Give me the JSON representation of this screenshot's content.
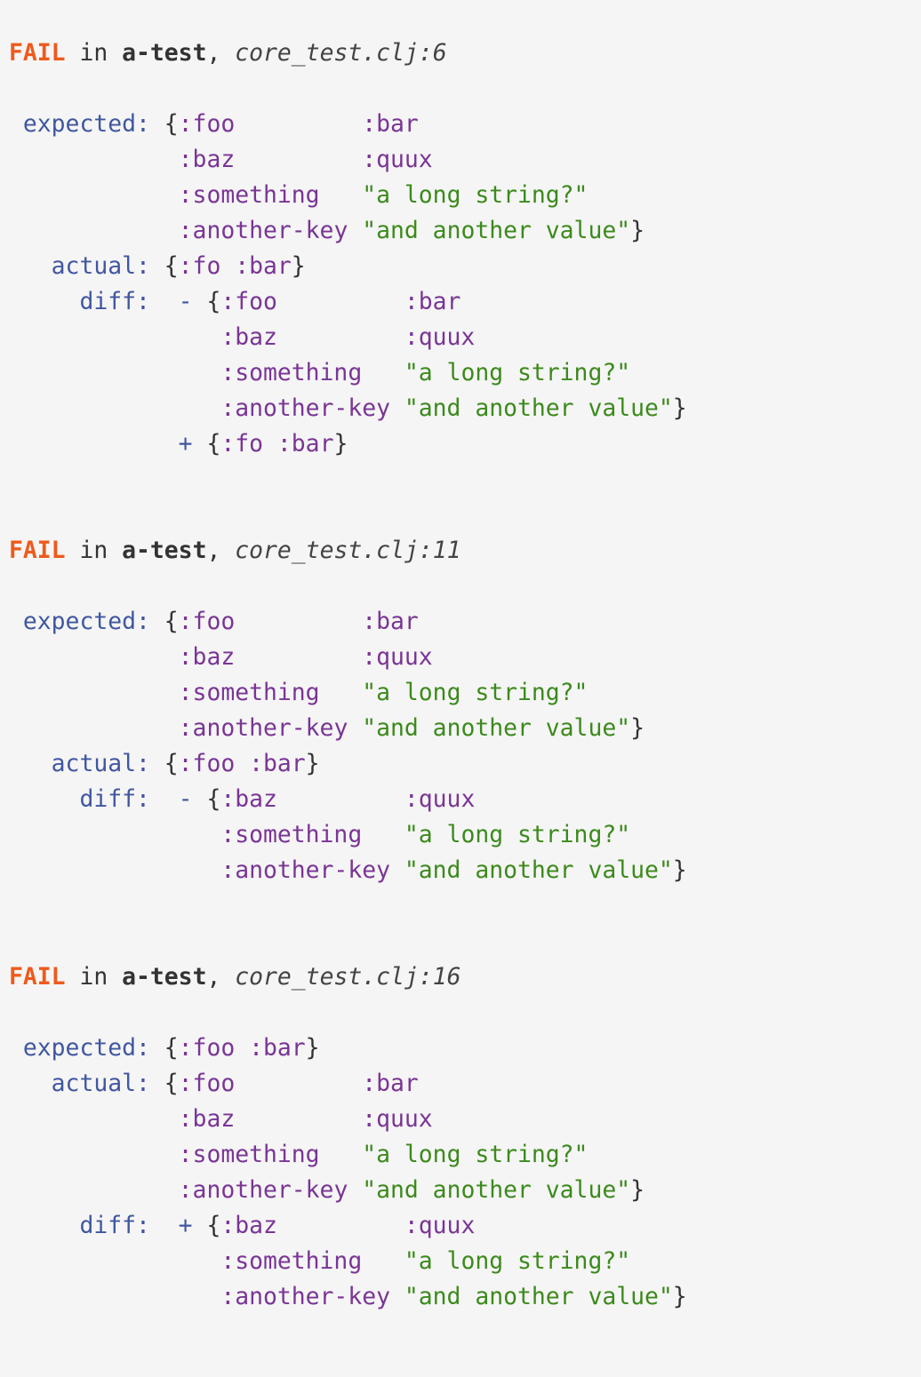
{
  "colors": {
    "background": "#f5f5f5",
    "fail": "#ee5a1c",
    "label": "#4057a0",
    "keyword": "#7a3595",
    "string": "#3c8a1c",
    "text": "#333333"
  },
  "failures": [
    {
      "header": {
        "fail": "FAIL",
        "in": " in ",
        "test": "a-test",
        "comma": ", ",
        "location": "core_test.clj:6"
      },
      "lines": [
        [
          [
            "label",
            " expected: "
          ],
          [
            "punct",
            "{"
          ],
          [
            "key",
            ":foo         :bar"
          ]
        ],
        [
          [
            "ws",
            "            "
          ],
          [
            "key",
            ":baz         :quux"
          ]
        ],
        [
          [
            "ws",
            "            "
          ],
          [
            "key",
            ":something   "
          ],
          [
            "str",
            "\"a long string?\""
          ]
        ],
        [
          [
            "ws",
            "            "
          ],
          [
            "key",
            ":another-key "
          ],
          [
            "str",
            "\"and another value\""
          ],
          [
            "punct",
            "}"
          ]
        ],
        [
          [
            "label",
            "   actual: "
          ],
          [
            "punct",
            "{"
          ],
          [
            "key",
            ":fo :bar"
          ],
          [
            "punct",
            "}"
          ]
        ],
        [
          [
            "label",
            "     diff: "
          ],
          [
            "op",
            " - "
          ],
          [
            "punct",
            "{"
          ],
          [
            "key",
            ":foo         :bar"
          ]
        ],
        [
          [
            "ws",
            "               "
          ],
          [
            "key",
            ":baz         :quux"
          ]
        ],
        [
          [
            "ws",
            "               "
          ],
          [
            "key",
            ":something   "
          ],
          [
            "str",
            "\"a long string?\""
          ]
        ],
        [
          [
            "ws",
            "               "
          ],
          [
            "key",
            ":another-key "
          ],
          [
            "str",
            "\"and another value\""
          ],
          [
            "punct",
            "}"
          ]
        ],
        [
          [
            "ws",
            "           "
          ],
          [
            "op",
            " + "
          ],
          [
            "punct",
            "{"
          ],
          [
            "key",
            ":fo :bar"
          ],
          [
            "punct",
            "}"
          ]
        ]
      ]
    },
    {
      "header": {
        "fail": "FAIL",
        "in": " in ",
        "test": "a-test",
        "comma": ", ",
        "location": "core_test.clj:11"
      },
      "lines": [
        [
          [
            "label",
            " expected: "
          ],
          [
            "punct",
            "{"
          ],
          [
            "key",
            ":foo         :bar"
          ]
        ],
        [
          [
            "ws",
            "            "
          ],
          [
            "key",
            ":baz         :quux"
          ]
        ],
        [
          [
            "ws",
            "            "
          ],
          [
            "key",
            ":something   "
          ],
          [
            "str",
            "\"a long string?\""
          ]
        ],
        [
          [
            "ws",
            "            "
          ],
          [
            "key",
            ":another-key "
          ],
          [
            "str",
            "\"and another value\""
          ],
          [
            "punct",
            "}"
          ]
        ],
        [
          [
            "label",
            "   actual: "
          ],
          [
            "punct",
            "{"
          ],
          [
            "key",
            ":foo :bar"
          ],
          [
            "punct",
            "}"
          ]
        ],
        [
          [
            "label",
            "     diff: "
          ],
          [
            "op",
            " - "
          ],
          [
            "punct",
            "{"
          ],
          [
            "key",
            ":baz         :quux"
          ]
        ],
        [
          [
            "ws",
            "               "
          ],
          [
            "key",
            ":something   "
          ],
          [
            "str",
            "\"a long string?\""
          ]
        ],
        [
          [
            "ws",
            "               "
          ],
          [
            "key",
            ":another-key "
          ],
          [
            "str",
            "\"and another value\""
          ],
          [
            "punct",
            "}"
          ]
        ]
      ]
    },
    {
      "header": {
        "fail": "FAIL",
        "in": " in ",
        "test": "a-test",
        "comma": ", ",
        "location": "core_test.clj:16"
      },
      "lines": [
        [
          [
            "label",
            " expected: "
          ],
          [
            "punct",
            "{"
          ],
          [
            "key",
            ":foo :bar"
          ],
          [
            "punct",
            "}"
          ]
        ],
        [
          [
            "label",
            "   actual: "
          ],
          [
            "punct",
            "{"
          ],
          [
            "key",
            ":foo         :bar"
          ]
        ],
        [
          [
            "ws",
            "            "
          ],
          [
            "key",
            ":baz         :quux"
          ]
        ],
        [
          [
            "ws",
            "            "
          ],
          [
            "key",
            ":something   "
          ],
          [
            "str",
            "\"a long string?\""
          ]
        ],
        [
          [
            "ws",
            "            "
          ],
          [
            "key",
            ":another-key "
          ],
          [
            "str",
            "\"and another value\""
          ],
          [
            "punct",
            "}"
          ]
        ],
        [
          [
            "label",
            "     diff: "
          ],
          [
            "op",
            " + "
          ],
          [
            "punct",
            "{"
          ],
          [
            "key",
            ":baz         :quux"
          ]
        ],
        [
          [
            "ws",
            "               "
          ],
          [
            "key",
            ":something   "
          ],
          [
            "str",
            "\"a long string?\""
          ]
        ],
        [
          [
            "ws",
            "               "
          ],
          [
            "key",
            ":another-key "
          ],
          [
            "str",
            "\"and another value\""
          ],
          [
            "punct",
            "}"
          ]
        ]
      ]
    }
  ]
}
